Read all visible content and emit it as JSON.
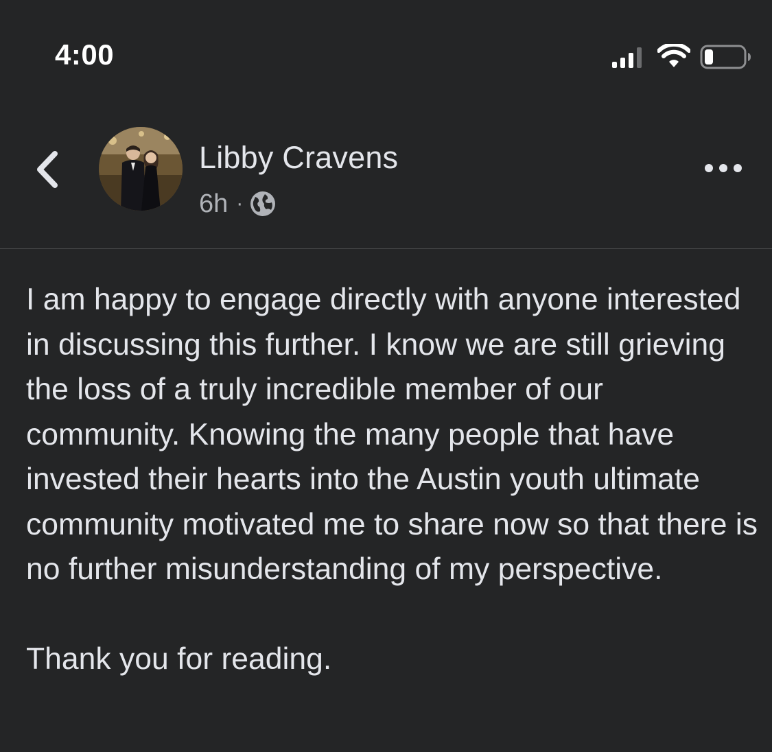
{
  "status_bar": {
    "time": "4:00"
  },
  "post": {
    "author": "Libby Cravens",
    "time_ago": "6h",
    "separator": "·",
    "audience_icon": "globe-icon",
    "avatar_description": "profile-photo",
    "body_paragraph": "I am happy to engage directly with anyone interested in discussing this further. I know we are still grieving the loss of a truly incredible member of our community. Knowing the many people that have invested their hearts into the Austin youth ultimate community motivated me to share now so that there is no further misunderstanding of my perspective.",
    "closing": "Thank you for reading."
  },
  "colors": {
    "background": "#242526",
    "text_primary": "#e4e6eb",
    "text_secondary": "#b0b3b8",
    "divider": "#4a4b4d"
  }
}
